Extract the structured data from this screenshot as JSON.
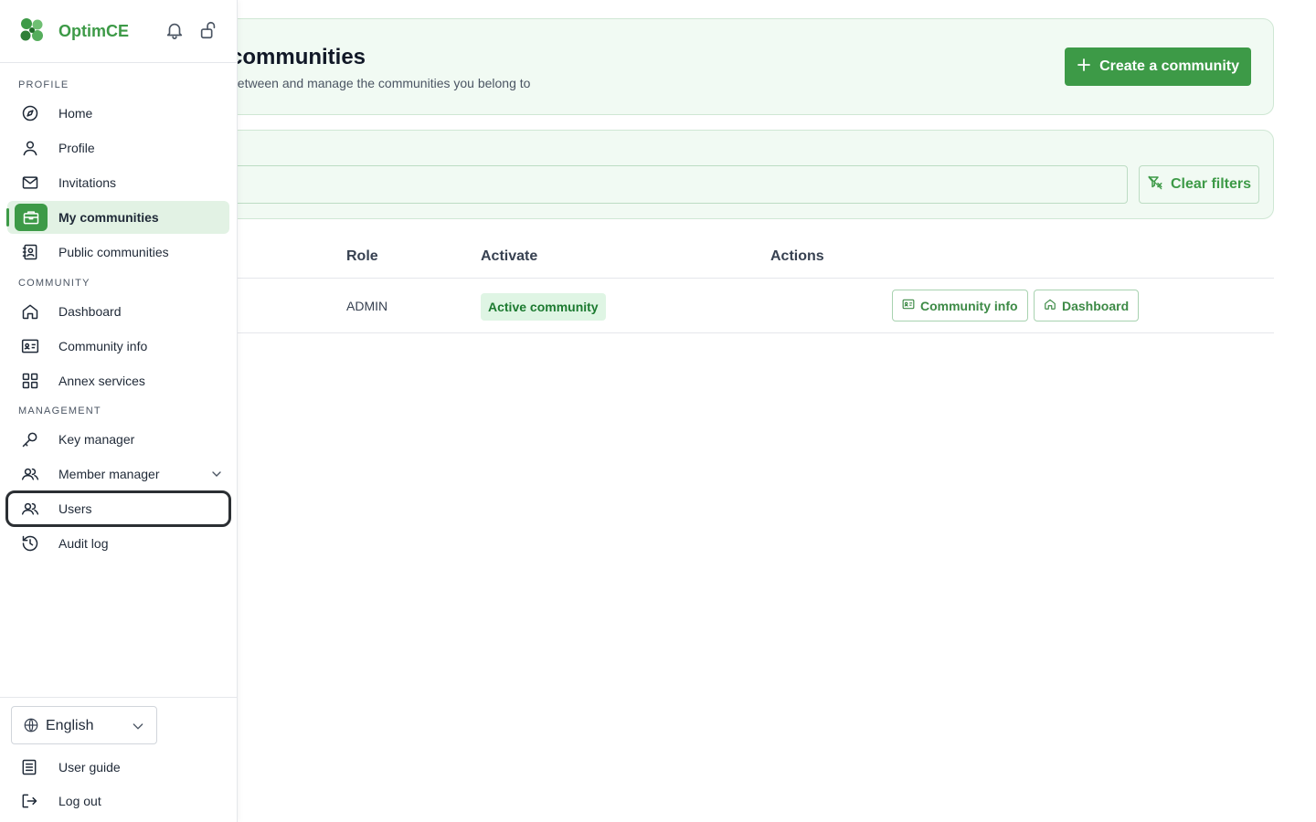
{
  "app": {
    "brand": "OptimCE"
  },
  "colors": {
    "accent": "#3d9a47",
    "accent_light": "#e2f2e4",
    "card_bg": "#f1faf3"
  },
  "header": {
    "title": "communities",
    "subtitle": "between and manage the communities you belong to",
    "create_label": "Create a community"
  },
  "filters": {
    "search_value": "",
    "clear_label": "Clear filters"
  },
  "table": {
    "columns": [
      "Role",
      "Activate",
      "Actions"
    ],
    "rows": [
      {
        "role": "ADMIN",
        "status": "Active community",
        "actions": [
          "Community info",
          "Dashboard"
        ]
      }
    ]
  },
  "sidebar": {
    "sections": {
      "profile": "PROFILE",
      "community": "COMMUNITY",
      "management": "MANAGEMENT"
    },
    "items": {
      "home": "Home",
      "profile": "Profile",
      "invitations": "Invitations",
      "my_communities": "My communities",
      "public_communities": "Public communities",
      "dashboard": "Dashboard",
      "community_info": "Community info",
      "annex_services": "Annex services",
      "key_manager": "Key manager",
      "member_manager": "Member manager",
      "users": "Users",
      "audit_log": "Audit log"
    },
    "language": "English",
    "user_guide": "User guide",
    "log_out": "Log out"
  },
  "icons": [
    "bell-icon",
    "unlock-icon",
    "compass-icon",
    "user-icon",
    "mail-icon",
    "briefcase-icon",
    "contact-icon",
    "house-icon",
    "id-card-icon",
    "grid-icon",
    "key-icon",
    "users-icon",
    "history-icon",
    "globe-icon",
    "book-icon",
    "logout-icon",
    "plus-icon",
    "filter-x-icon",
    "chevron-down-icon"
  ]
}
